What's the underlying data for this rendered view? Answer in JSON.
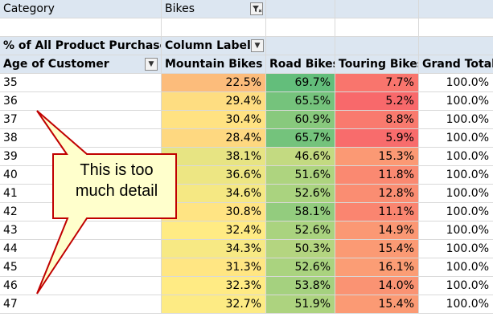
{
  "filter": {
    "field": "Category",
    "value": "Bikes"
  },
  "pivot": {
    "value_label": "% of All Product Purchases",
    "column_labels": "Column Labels",
    "row_field": "Age of Customer",
    "columns": [
      "Mountain Bikes",
      "Road Bikes",
      "Touring Bikes",
      "Grand Total"
    ],
    "rows": [
      {
        "age": "35",
        "values": [
          "22.5%",
          "69.7%",
          "7.7%",
          "100.0%"
        ]
      },
      {
        "age": "36",
        "values": [
          "29.4%",
          "65.5%",
          "5.2%",
          "100.0%"
        ]
      },
      {
        "age": "37",
        "values": [
          "30.4%",
          "60.9%",
          "8.8%",
          "100.0%"
        ]
      },
      {
        "age": "38",
        "values": [
          "28.4%",
          "65.7%",
          "5.9%",
          "100.0%"
        ]
      },
      {
        "age": "39",
        "values": [
          "38.1%",
          "46.6%",
          "15.3%",
          "100.0%"
        ]
      },
      {
        "age": "40",
        "values": [
          "36.6%",
          "51.6%",
          "11.8%",
          "100.0%"
        ]
      },
      {
        "age": "41",
        "values": [
          "34.6%",
          "52.6%",
          "12.8%",
          "100.0%"
        ]
      },
      {
        "age": "42",
        "values": [
          "30.8%",
          "58.1%",
          "11.1%",
          "100.0%"
        ]
      },
      {
        "age": "43",
        "values": [
          "32.4%",
          "52.6%",
          "14.9%",
          "100.0%"
        ]
      },
      {
        "age": "44",
        "values": [
          "34.3%",
          "50.3%",
          "15.4%",
          "100.0%"
        ]
      },
      {
        "age": "45",
        "values": [
          "31.3%",
          "52.6%",
          "16.1%",
          "100.0%"
        ]
      },
      {
        "age": "46",
        "values": [
          "32.3%",
          "53.8%",
          "14.0%",
          "100.0%"
        ]
      },
      {
        "age": "47",
        "values": [
          "32.7%",
          "51.9%",
          "15.4%",
          "100.0%"
        ]
      }
    ]
  },
  "callout": {
    "line1": "This is too",
    "line2": "much detail"
  },
  "colors": {
    "header_fill": "#dce6f1",
    "callout_fill": "#ffffcc",
    "callout_border": "#c00000",
    "scale_low": "#f8696b",
    "scale_mid": "#ffeb84",
    "scale_high": "#63be7b"
  },
  "icons": {
    "filter_button": "filter-funnel-icon",
    "dropdown_button": "dropdown-arrow-icon"
  }
}
